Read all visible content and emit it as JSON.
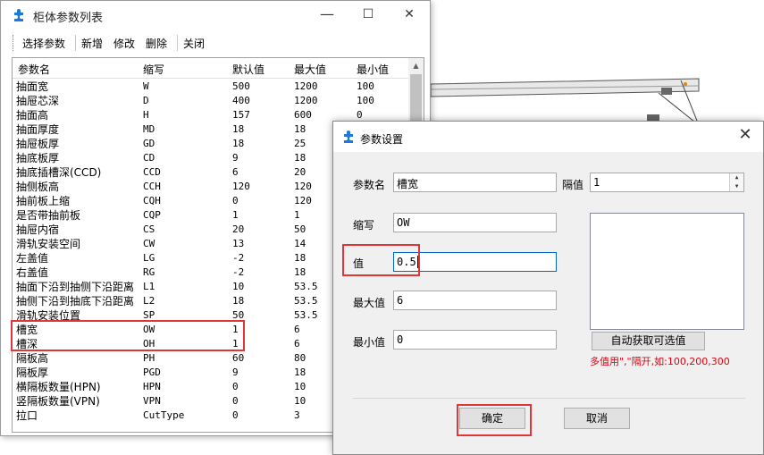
{
  "main_window": {
    "title": "柜体参数列表",
    "controls": {
      "minimize": "—",
      "maximize": "☐",
      "close": "✕"
    },
    "toolbar": [
      "选择参数",
      "新增",
      "修改",
      "删除",
      "关闭"
    ],
    "columns": [
      "参数名",
      "缩写",
      "默认值",
      "最大值",
      "最小值"
    ],
    "rows": [
      [
        "抽面宽",
        "W",
        "500",
        "1200",
        "100"
      ],
      [
        "抽屉芯深",
        "D",
        "400",
        "1200",
        "100"
      ],
      [
        "抽面高",
        "H",
        "157",
        "600",
        "0"
      ],
      [
        "抽面厚度",
        "MD",
        "18",
        "18",
        ""
      ],
      [
        "抽屉板厚",
        "GD",
        "18",
        "25",
        ""
      ],
      [
        "抽底板厚",
        "CD",
        "9",
        "18",
        ""
      ],
      [
        "抽底插槽深(CCD)",
        "CCD",
        "6",
        "20",
        ""
      ],
      [
        "抽侧板高",
        "CCH",
        "120",
        "120",
        ""
      ],
      [
        "抽前板上缩",
        "CQH",
        "0",
        "120",
        ""
      ],
      [
        "是否带抽前板",
        "CQP",
        "1",
        "1",
        ""
      ],
      [
        "抽屉内宿",
        "CS",
        "20",
        "50",
        ""
      ],
      [
        "滑轨安装空间",
        "CW",
        "13",
        "14",
        ""
      ],
      [
        "左盖值",
        "LG",
        "-2",
        "18",
        ""
      ],
      [
        "右盖值",
        "RG",
        "-2",
        "18",
        ""
      ],
      [
        "抽面下沿到抽侧下沿距离",
        "L1",
        "10",
        "53.5",
        ""
      ],
      [
        "抽侧下沿到抽底下沿距离",
        "L2",
        "18",
        "53.5",
        ""
      ],
      [
        "滑轨安装位置",
        "SP",
        "50",
        "53.5",
        ""
      ],
      [
        "槽宽",
        "OW",
        "1",
        "6",
        ""
      ],
      [
        "槽深",
        "OH",
        "1",
        "6",
        ""
      ],
      [
        "隔板高",
        "PH",
        "60",
        "80",
        ""
      ],
      [
        "隔板厚",
        "PGD",
        "9",
        "18",
        ""
      ],
      [
        "横隔板数量(HPN)",
        "HPN",
        "0",
        "10",
        ""
      ],
      [
        "竖隔板数量(VPN)",
        "VPN",
        "0",
        "10",
        ""
      ],
      [
        "拉口",
        "CutType",
        "0",
        "3",
        ""
      ]
    ]
  },
  "dialog": {
    "title": "参数设置",
    "close": "✕",
    "labels": {
      "name": "参数名",
      "abbr": "缩写",
      "value": "值",
      "max": "最大值",
      "min": "最小值",
      "interval": "隔值"
    },
    "values": {
      "name": "槽宽",
      "abbr": "OW",
      "value": "0.5",
      "max": "6",
      "min": "0",
      "interval": "1"
    },
    "auto_button": "自动获取可选值",
    "hint": "多值用\",\"隔开,如:100,200,300",
    "ok": "确定",
    "cancel": "取消"
  },
  "colors": {
    "highlight_box": "#e0353a",
    "hint_text": "#e0000f",
    "focus_border": "#0066cc"
  }
}
